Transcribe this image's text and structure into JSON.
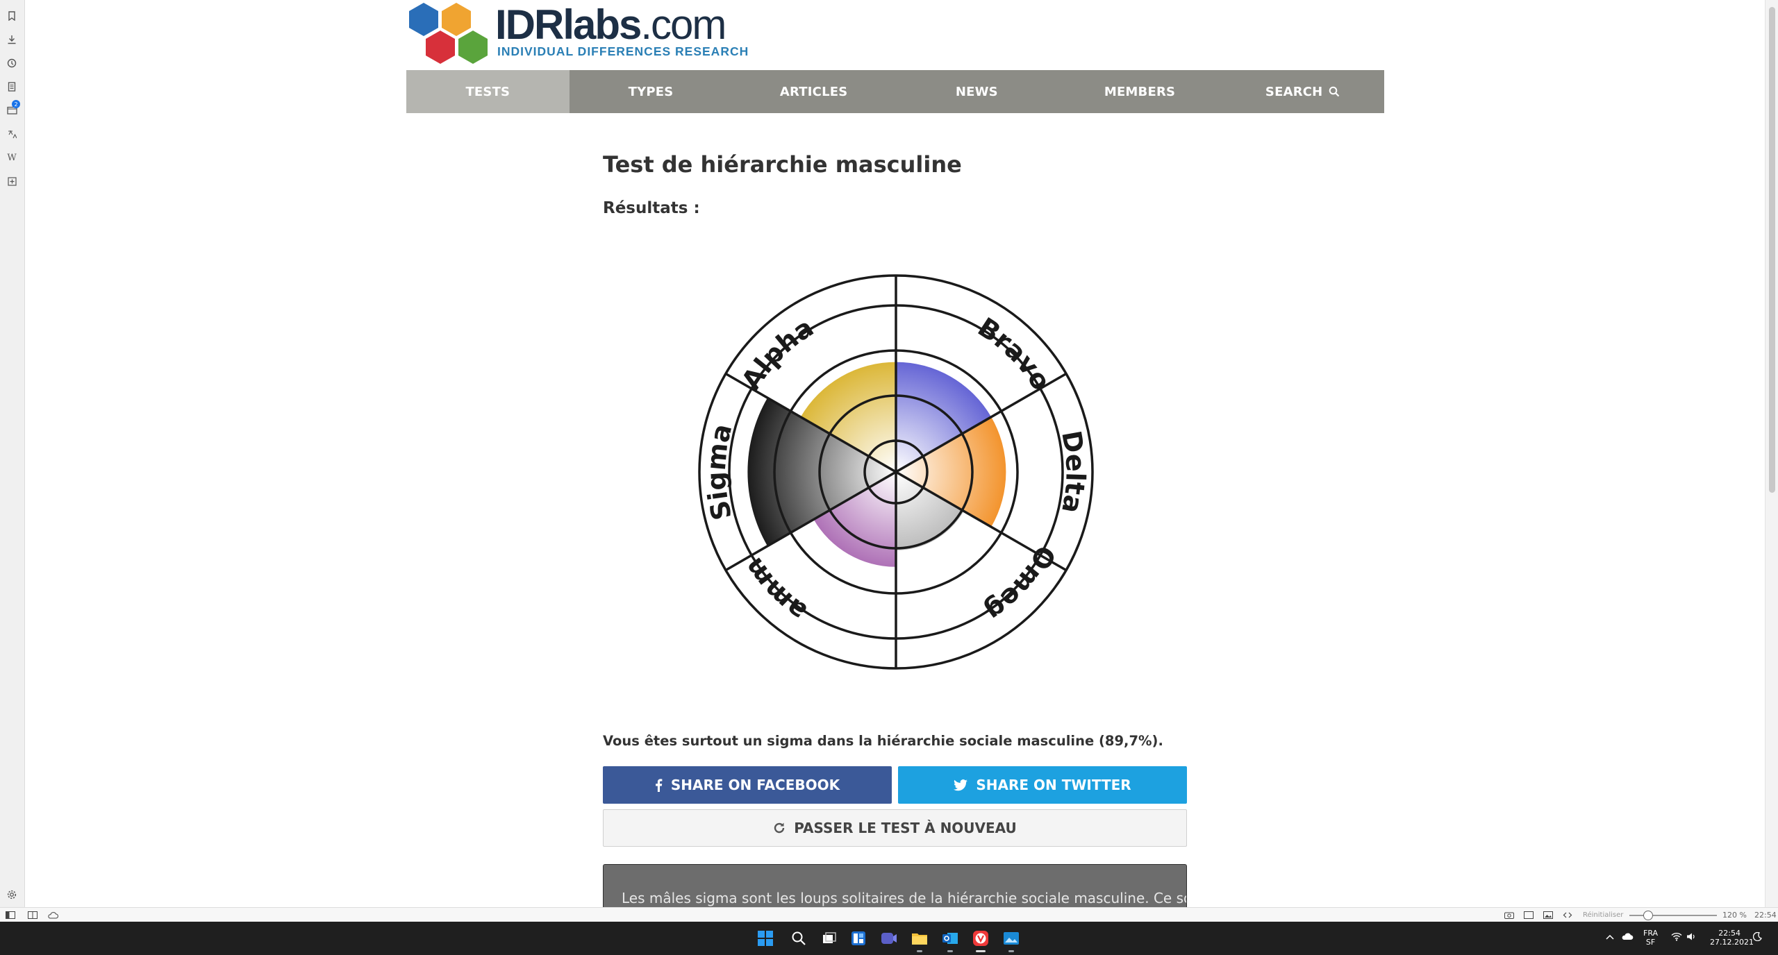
{
  "site": {
    "logo_text": "IDRlabs",
    "logo_domain": ".com",
    "logo_tagline": "INDIVIDUAL DIFFERENCES RESEARCH"
  },
  "nav": {
    "items": [
      {
        "label": "TESTS",
        "active": true
      },
      {
        "label": "TYPES",
        "active": false
      },
      {
        "label": "ARTICLES",
        "active": false
      },
      {
        "label": "NEWS",
        "active": false
      },
      {
        "label": "MEMBERS",
        "active": false
      },
      {
        "label": "SEARCH",
        "active": false,
        "icon": "search-icon"
      }
    ]
  },
  "main": {
    "title": "Test de hiérarchie masculine",
    "results_label": "Résultats :",
    "result_text": "Vous êtes surtout un sigma dans la hiérarchie sociale masculine (89,7%).",
    "share_facebook": "SHARE ON FACEBOOK",
    "share_twitter": "SHARE ON TWITTER",
    "retake": "PASSER LE TEST À NOUVEAU",
    "description": "Les mâles sigma sont les loups solitaires de la hiérarchie sociale masculine. Ce sont"
  },
  "chart_data": {
    "type": "polar_area",
    "categories": [
      "Bravo",
      "Delta",
      "Omega",
      "Gamma",
      "Sigma",
      "Alpha"
    ],
    "values": [
      0.66,
      0.66,
      0.47,
      0.57,
      0.89,
      0.66
    ],
    "colors": [
      "#5a5ad2",
      "#f28c1e",
      "#9a9a9a",
      "#9b4fa5",
      "#000000",
      "#d9b22a"
    ],
    "rings": 4,
    "grid": true
  },
  "sidepanel": {
    "icons": [
      "bookmark-icon",
      "download-icon",
      "history-icon",
      "notes-icon",
      "mail-icon",
      "translate-icon",
      "wikipedia-icon",
      "add-panel-icon",
      "settings-icon"
    ],
    "mail_badge": "2"
  },
  "statusbar": {
    "reset_label": "Réinitialiser",
    "zoom": "120 %",
    "clock": "22:54"
  },
  "taskbar": {
    "language": "FRA",
    "language_sub": "SF",
    "time": "22:54",
    "date": "27.12.2021"
  }
}
